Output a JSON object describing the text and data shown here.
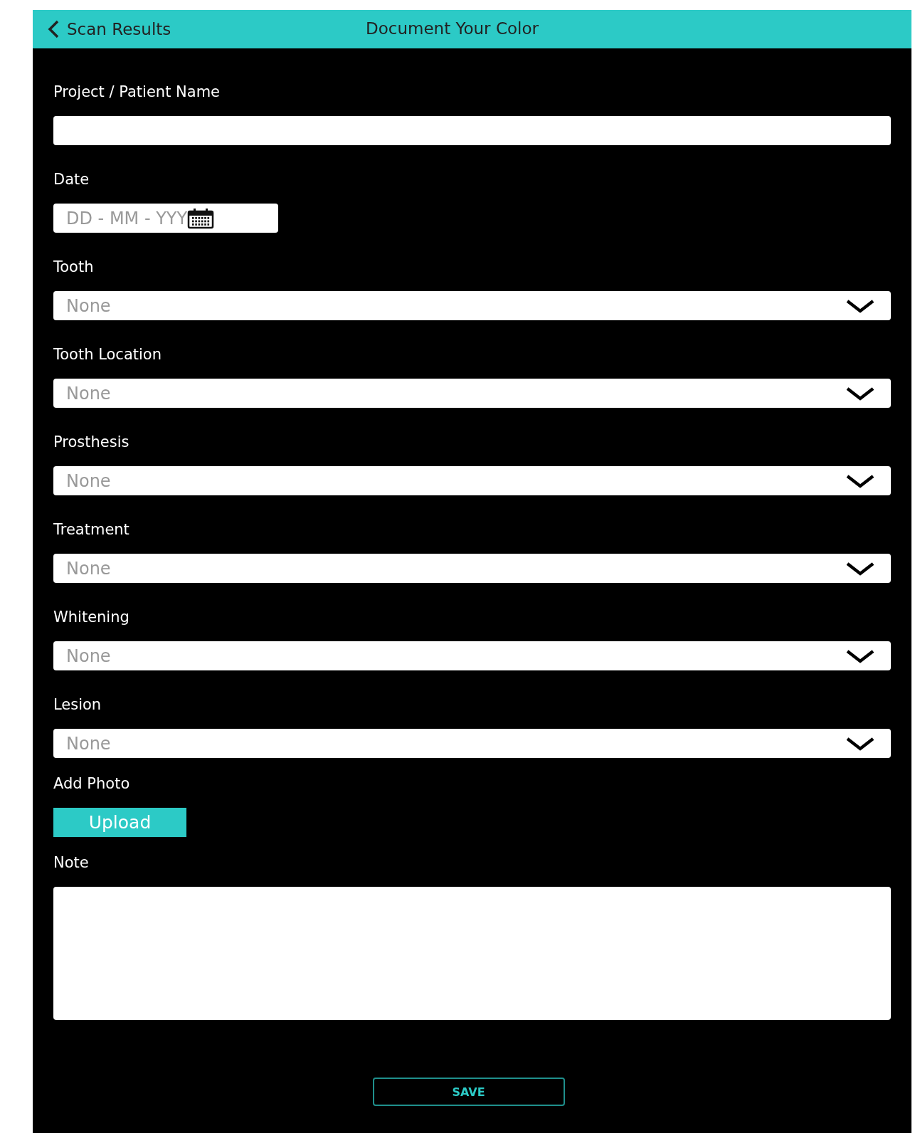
{
  "header": {
    "back_label": "Scan Results",
    "title": "Document Your Color"
  },
  "fields": [
    {
      "kind": "text",
      "label": "Project / Patient Name"
    },
    {
      "kind": "date",
      "label": "Date",
      "placeholder": "DD - MM - YYY"
    },
    {
      "kind": "select",
      "label": "Tooth",
      "placeholder": "None"
    },
    {
      "kind": "select",
      "label": "Tooth Location",
      "placeholder": "None"
    },
    {
      "kind": "select",
      "label": "Prosthesis",
      "placeholder": "None"
    },
    {
      "kind": "select",
      "label": "Treatment",
      "placeholder": "None"
    },
    {
      "kind": "select",
      "label": "Whitening",
      "placeholder": "None"
    },
    {
      "kind": "select",
      "label": "Lesion",
      "placeholder": "None"
    },
    {
      "kind": "upload",
      "label": "Add Photo",
      "button": "Upload"
    },
    {
      "kind": "textarea",
      "label": "Note"
    }
  ],
  "save_button": "SAVE"
}
